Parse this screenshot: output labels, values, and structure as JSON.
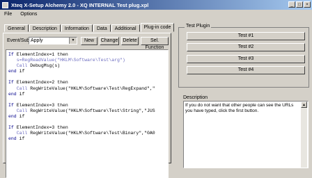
{
  "window": {
    "title": "Xteq X-Setup Alchemy 2.0 - XQ INTERNAL Test plug.xpl"
  },
  "menu": [
    {
      "label": "File"
    },
    {
      "label": "Options"
    }
  ],
  "tabs": [
    {
      "label": "General"
    },
    {
      "label": "Description"
    },
    {
      "label": "Information"
    },
    {
      "label": "Data"
    },
    {
      "label": "Additional"
    },
    {
      "label": "Plug-in code",
      "active": true
    }
  ],
  "toolbar": {
    "event_label": "Event/Sub",
    "event_value": "Apply",
    "new_label": "New",
    "change_label": "Change",
    "delete_label": "Delete",
    "sel_function_label": "Sel. Function"
  },
  "code": {
    "blocks": [
      {
        "lines": [
          "If ElementIndex=1 then",
          "   s=RegReadValue(\"HKLM\\Software\\Test\\arg\")",
          "   Call DebugMsg(s)",
          "end if"
        ]
      },
      {
        "lines": [
          "If ElementIndex=2 then",
          "   Call RegWriteValue(\"HKLM\\Software\\Test\\RegExpand\",\"",
          "end if"
        ]
      },
      {
        "lines": [
          "If ElementIndex=3 then",
          "   Call RegWriteValue(\"HKLM\\Software\\Test\\String\",\"JUS",
          "end if"
        ]
      },
      {
        "lines": [
          "If ElementIndex=3 then",
          "   Call RegWriteValue(\"HKLM\\Software\\Test\\Binary\",\"0A0",
          "end if"
        ]
      }
    ]
  },
  "test_plugin": {
    "group_label": "Test Plugin",
    "buttons": [
      {
        "label": "Test #1"
      },
      {
        "label": "Test #2"
      },
      {
        "label": "Test #3"
      },
      {
        "label": "Test #4"
      }
    ]
  },
  "description": {
    "label": "Description",
    "text": "If you do not want that other people can see the URLs you have typed, click the first button."
  }
}
